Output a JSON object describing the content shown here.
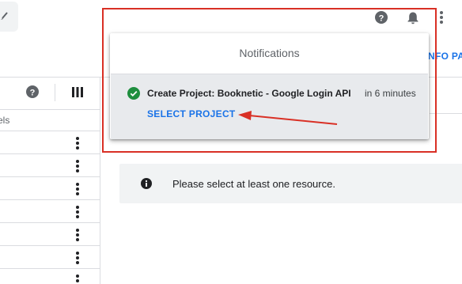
{
  "notifications": {
    "title": "Notifications",
    "item": {
      "text": "Create Project: Booknetic - Google Login API",
      "time": "in 6 minutes",
      "action": "SELECT PROJECT"
    }
  },
  "header": {
    "info_panel_label": "NFO PA"
  },
  "table": {
    "column_label": "els",
    "row_count": 7
  },
  "main": {
    "empty_message": "Please select at least one resource."
  },
  "icons": {
    "help": "help-icon",
    "bell": "bell-icon",
    "more": "more-vert-icon",
    "columns": "columns-icon",
    "check": "check-circle-icon",
    "info": "info-icon",
    "kebab": "kebab-menu-icon"
  },
  "colors": {
    "accent": "#1a73e8",
    "success": "#1e8e3e",
    "annotation": "#d93025"
  }
}
